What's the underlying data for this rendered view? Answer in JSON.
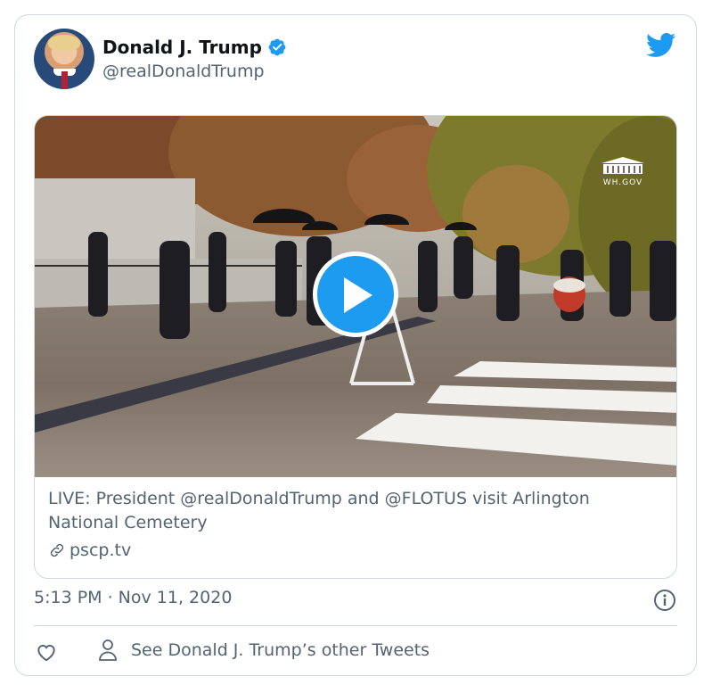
{
  "tweet": {
    "display_name": "Donald J. Trump",
    "handle": "@realDonaldTrump",
    "timestamp": "5:13 PM · Nov 11, 2020"
  },
  "media": {
    "watermark": "WH.GOV",
    "link_title": "LIVE: President @realDonaldTrump and @FLOTUS visit Arlington National Cemetery",
    "link_host": "pscp.tv"
  },
  "footer": {
    "other_tweets_label": "See Donald J. Trump’s other Tweets"
  },
  "colors": {
    "brand_blue": "#1d9bf0",
    "secondary_text": "#536471",
    "border": "#cfd9de"
  },
  "icons": {
    "verified": "verified-badge-icon",
    "brand": "twitter-bird-icon",
    "play": "play-icon",
    "link": "link-icon",
    "info": "info-icon",
    "like": "heart-icon",
    "profile": "person-icon"
  }
}
